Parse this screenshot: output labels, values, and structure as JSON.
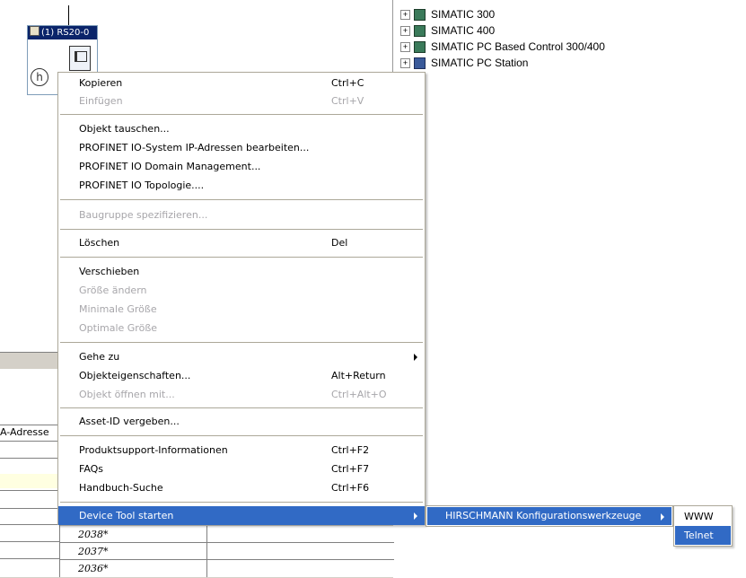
{
  "station": {
    "title": "(1) RS20-0",
    "badge": "h"
  },
  "tree": {
    "items": [
      {
        "label": "SIMATIC 300",
        "icon": "simatic-rack-icon"
      },
      {
        "label": "SIMATIC 400",
        "icon": "simatic-rack-icon"
      },
      {
        "label": "SIMATIC PC Based Control 300/400",
        "icon": "simatic-rack-icon"
      },
      {
        "label": "SIMATIC PC Station",
        "icon": "pc-station-icon"
      }
    ],
    "expander": "+"
  },
  "grid": {
    "header": "A-Adresse",
    "values": [
      "2038*",
      "2037*",
      "2036*"
    ]
  },
  "menu": {
    "copy": {
      "label": "Kopieren",
      "shortcut": "Ctrl+C"
    },
    "paste": {
      "label": "Einfügen",
      "shortcut": "Ctrl+V"
    },
    "replace_object": {
      "label": "Objekt tauschen..."
    },
    "profinet_ip": {
      "label": "PROFINET IO-System IP-Adressen bearbeiten..."
    },
    "profinet_domain": {
      "label": "PROFINET IO Domain Management..."
    },
    "profinet_topology": {
      "label": "PROFINET IO Topologie...."
    },
    "specify_module": {
      "label": "Baugruppe spezifizieren..."
    },
    "delete": {
      "label": "Löschen",
      "shortcut": "Del"
    },
    "move": {
      "label": "Verschieben"
    },
    "resize": {
      "label": "Größe ändern"
    },
    "min_size": {
      "label": "Minimale Größe"
    },
    "opt_size": {
      "label": "Optimale Größe"
    },
    "goto": {
      "label": "Gehe zu"
    },
    "properties": {
      "label": "Objekteigenschaften...",
      "shortcut": "Alt+Return"
    },
    "open_with": {
      "label": "Objekt öffnen mit...",
      "shortcut": "Ctrl+Alt+O"
    },
    "asset_id": {
      "label": "Asset-ID vergeben..."
    },
    "product_support": {
      "label": "Produktsupport-Informationen",
      "shortcut": "Ctrl+F2"
    },
    "faqs": {
      "label": "FAQs",
      "shortcut": "Ctrl+F7"
    },
    "manual_search": {
      "label": "Handbuch-Suche",
      "shortcut": "Ctrl+F6"
    },
    "device_tool": {
      "label": "Device Tool starten"
    }
  },
  "submenu1": {
    "label": "HIRSCHMANN Konfigurationswerkzeuge"
  },
  "submenu2": {
    "items": [
      "WWW",
      "Telnet"
    ]
  },
  "colors": {
    "highlight": "#316ac5",
    "disabled": "#a7a6aa"
  }
}
